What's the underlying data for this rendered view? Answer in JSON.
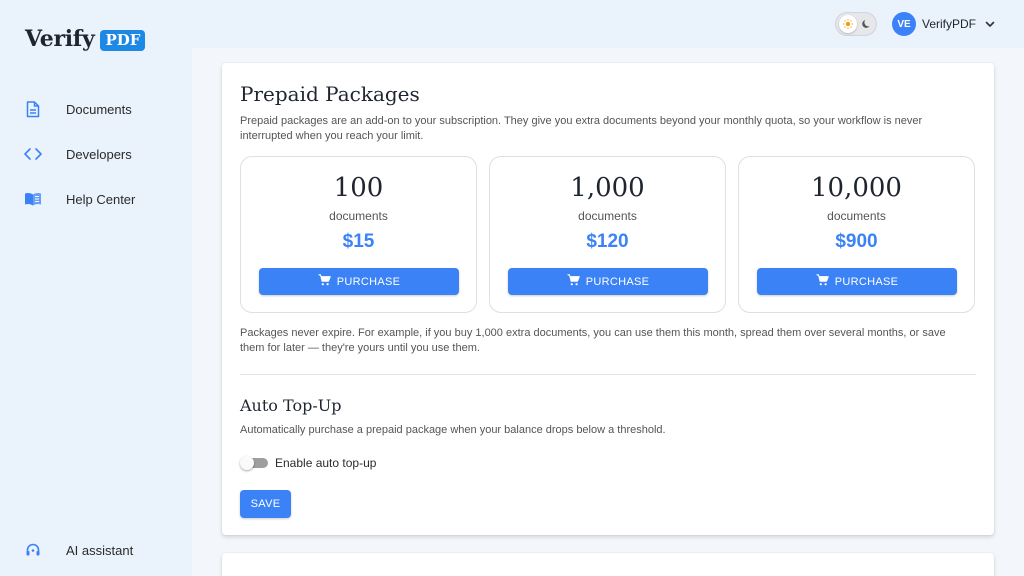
{
  "brand": {
    "name": "Verify",
    "badge": "PDF"
  },
  "sidebar": {
    "items": [
      {
        "label": "Documents",
        "icon": "document-icon"
      },
      {
        "label": "Developers",
        "icon": "code-icon"
      },
      {
        "label": "Help Center",
        "icon": "book-icon"
      }
    ],
    "bottom_item": {
      "label": "AI assistant",
      "icon": "headset-icon"
    }
  },
  "header": {
    "user_initials": "VE",
    "user_name": "VerifyPDF"
  },
  "prepaid": {
    "title": "Prepaid Packages",
    "description": "Prepaid packages are an add-on to your subscription. They give you extra documents beyond your monthly quota, so your workflow is never interrupted when you reach your limit.",
    "packages": [
      {
        "count": "100",
        "unit": "documents",
        "price": "$15",
        "button": "PURCHASE"
      },
      {
        "count": "1,000",
        "unit": "documents",
        "price": "$120",
        "button": "PURCHASE"
      },
      {
        "count": "10,000",
        "unit": "documents",
        "price": "$900",
        "button": "PURCHASE"
      }
    ],
    "note": "Packages never expire. For example, if you buy 1,000 extra documents, you can use them this month, spread them over several months, or save them for later — they're yours until you use them."
  },
  "auto_topup": {
    "title": "Auto Top-Up",
    "description": "Automatically purchase a prepaid package when your balance drops below a threshold.",
    "toggle_label": "Enable auto top-up",
    "toggle_on": false,
    "save_label": "SAVE"
  },
  "colors": {
    "accent": "#3b82f6",
    "brand_badge": "#1e88e5"
  }
}
